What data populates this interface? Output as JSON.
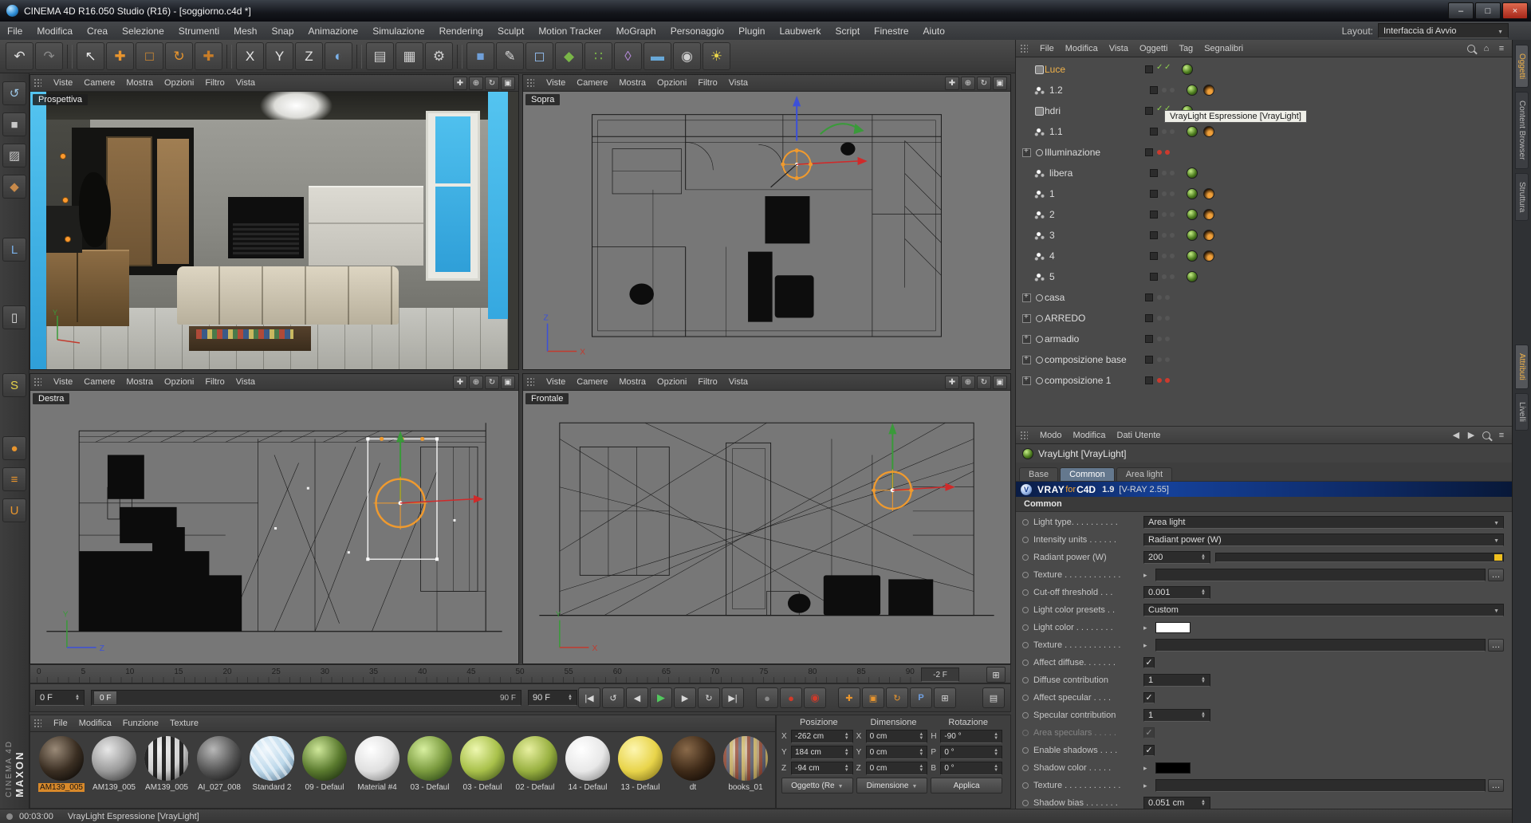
{
  "window": {
    "title": "CINEMA 4D R16.050 Studio (R16) - [soggiorno.c4d *]",
    "controls": {
      "minimize": "–",
      "maximize": "□",
      "close": "×"
    }
  },
  "menubar": {
    "items": [
      "File",
      "Modifica",
      "Crea",
      "Selezione",
      "Strumenti",
      "Mesh",
      "Snap",
      "Animazione",
      "Simulazione",
      "Rendering",
      "Sculpt",
      "Motion Tracker",
      "MoGraph",
      "Personaggio",
      "Plugin",
      "Laubwerk",
      "Script",
      "Finestre",
      "Aiuto"
    ],
    "layout_label": "Layout:",
    "layout_value": "Interfaccia di Avvio"
  },
  "toolbar": {
    "items": [
      {
        "name": "undo-icon",
        "g": "↶",
        "c": "#e0e0e0",
        "cls": "",
        "inter": "true"
      },
      {
        "name": "redo-icon",
        "g": "↷",
        "c": "#8a8a8a",
        "cls": "",
        "inter": "true"
      },
      {
        "name": "toolbar-separator",
        "g": "",
        "c": "",
        "cls": "tsep",
        "inter": "false"
      },
      {
        "name": "live-selection-icon",
        "g": "↖",
        "c": "#e8e8e8",
        "cls": "",
        "inter": "true"
      },
      {
        "name": "move-tool-icon",
        "g": "✚",
        "c": "#e8952e",
        "cls": "",
        "inter": "true"
      },
      {
        "name": "scale-tool-icon",
        "g": "□",
        "c": "#e8952e",
        "cls": "",
        "inter": "true"
      },
      {
        "name": "rotate-tool-icon",
        "g": "↻",
        "c": "#e8952e",
        "cls": "",
        "inter": "true"
      },
      {
        "name": "last-tool-icon",
        "g": "✚",
        "c": "#c87d28",
        "cls": "",
        "inter": "true"
      },
      {
        "name": "toolbar-separator",
        "g": "",
        "c": "",
        "cls": "tsep",
        "inter": "false"
      },
      {
        "name": "lock-x-button",
        "g": "X",
        "c": "#e4e4e4",
        "cls": "",
        "inter": "true"
      },
      {
        "name": "lock-y-button",
        "g": "Y",
        "c": "#e4e4e4",
        "cls": "",
        "inter": "true"
      },
      {
        "name": "lock-z-button",
        "g": "Z",
        "c": "#e4e4e4",
        "cls": "",
        "inter": "true"
      },
      {
        "name": "coord-system-icon",
        "g": "◐",
        "c": "#7ab0e8",
        "cls": "",
        "inter": "true"
      },
      {
        "name": "toolbar-separator",
        "g": "",
        "c": "",
        "cls": "tsep",
        "inter": "false"
      },
      {
        "name": "render-view-icon",
        "g": "▤",
        "c": "#cfcfcf",
        "cls": "",
        "inter": "true"
      },
      {
        "name": "render-picture-viewer-icon",
        "g": "▦",
        "c": "#cfcfcf",
        "cls": "",
        "inter": "true"
      },
      {
        "name": "render-settings-icon",
        "g": "⚙",
        "c": "#cfcfcf",
        "cls": "",
        "inter": "true"
      },
      {
        "name": "toolbar-separator",
        "g": "",
        "c": "",
        "cls": "tsep",
        "inter": "false"
      },
      {
        "name": "primitive-cube-icon",
        "g": "■",
        "c": "#6f9fd8",
        "cls": "",
        "inter": "true"
      },
      {
        "name": "spline-pen-icon",
        "g": "✎",
        "c": "#d8d8d8",
        "cls": "",
        "inter": "true"
      },
      {
        "name": "subdivision-surface-icon",
        "g": "◻",
        "c": "#8fb8e8",
        "cls": "",
        "inter": "true"
      },
      {
        "name": "cloner-icon",
        "g": "◆",
        "c": "#7ab648",
        "cls": "",
        "inter": "true"
      },
      {
        "name": "array-icon",
        "g": "∷",
        "c": "#7ab648",
        "cls": "",
        "inter": "true"
      },
      {
        "name": "deformer-icon",
        "g": "◊",
        "c": "#b48ad8",
        "cls": "",
        "inter": "true"
      },
      {
        "name": "floor-object-icon",
        "g": "▬",
        "c": "#68a8d8",
        "cls": "",
        "inter": "true"
      },
      {
        "name": "camera-object-icon",
        "g": "◉",
        "c": "#cfcfcf",
        "cls": "",
        "inter": "true"
      },
      {
        "name": "light-object-icon",
        "g": "☀",
        "c": "#e8d44a",
        "cls": "",
        "inter": "true"
      }
    ]
  },
  "leftbar": {
    "items": [
      {
        "name": "make-editable-icon",
        "g": "↺",
        "c": "#9ec8e8",
        "cls": ""
      },
      {
        "name": "model-mode-icon",
        "g": "■",
        "c": "#c8c8c8",
        "cls": ""
      },
      {
        "name": "texture-mode-icon",
        "g": "▨",
        "c": "#c8c8c8",
        "cls": ""
      },
      {
        "name": "polygons-mode-icon",
        "g": "◆",
        "c": "#c88a4a",
        "cls": ""
      },
      {
        "name": "axis-mode-icon",
        "g": "L",
        "c": "#7ab0e8",
        "cls": "gap"
      },
      {
        "name": "viewport-nav-icon",
        "g": "▯",
        "c": "#e0e0e0",
        "cls": "biggap"
      },
      {
        "name": "snap-icon",
        "g": "S",
        "c": "#e8d44a",
        "cls": "biggap"
      },
      {
        "name": "paint-tool-icon",
        "g": "●",
        "c": "#e8952e",
        "cls": "gap"
      },
      {
        "name": "layers-icon",
        "g": "≡",
        "c": "#e8952e",
        "cls": ""
      },
      {
        "name": "magnet-icon",
        "g": "U",
        "c": "#e8952e",
        "cls": ""
      }
    ]
  },
  "axis": {
    "x": "X",
    "y": "Y",
    "z": "Z"
  },
  "viewport_menus": [
    "Viste",
    "Camere",
    "Mostra",
    "Opzioni",
    "Filtro",
    "Vista"
  ],
  "vp_icons": [
    {
      "name": "pan-view-icon",
      "g": "✚"
    },
    {
      "name": "zoom-view-icon",
      "g": "⊕"
    },
    {
      "name": "rotate-view-icon",
      "g": "↻"
    },
    {
      "name": "maximize-view-icon",
      "g": "▣"
    }
  ],
  "viewports": {
    "v1": "Prospettiva",
    "v2": "Sopra",
    "v3": "Destra",
    "v4": "Frontale"
  },
  "object_manager": {
    "menus": [
      "File",
      "Modifica",
      "Vista",
      "Oggetti",
      "Tag",
      "Segnalibri"
    ],
    "tooltip": "VrayLight Espressione [VrayLight]",
    "objects": [
      {
        "nm": "object-row-luce",
        "name": "Luce",
        "icon": "ic-null",
        "exp": "",
        "sel": "sel",
        "dots": "dots-check",
        "tag1": "tag-vray",
        "tag2": "tag-none"
      },
      {
        "nm": "object-row-1-2",
        "name": "1.2",
        "icon": "ic-light",
        "exp": "",
        "sel": "",
        "dots": "dots-gray",
        "tag1": "tag-vray",
        "tag2": "tag-orange"
      },
      {
        "nm": "object-row-hdri",
        "name": "hdri",
        "icon": "ic-null",
        "exp": "",
        "sel": "",
        "dots": "dots-check",
        "tag1": "tag-vray",
        "tag2": "tag-none"
      },
      {
        "nm": "object-row-1-1",
        "name": "1.1",
        "icon": "ic-light",
        "exp": "",
        "sel": "",
        "dots": "dots-gray",
        "tag1": "tag-vray",
        "tag2": "tag-orange"
      },
      {
        "nm": "object-row-illuminazione",
        "name": "Illuminazione",
        "icon": "ic-nullL",
        "exp": "has-exp",
        "sel": "",
        "dots": "dots-red",
        "tag1": "tag-none",
        "tag2": "tag-none"
      },
      {
        "nm": "object-row-libera",
        "name": "libera",
        "icon": "ic-light",
        "exp": "",
        "sel": "",
        "dots": "dots-gray",
        "tag1": "tag-vray",
        "tag2": "tag-none"
      },
      {
        "nm": "object-row-1",
        "name": "1",
        "icon": "ic-light",
        "exp": "",
        "sel": "",
        "dots": "dots-gray",
        "tag1": "tag-vray",
        "tag2": "tag-orange"
      },
      {
        "nm": "object-row-2",
        "name": "2",
        "icon": "ic-light",
        "exp": "",
        "sel": "",
        "dots": "dots-gray",
        "tag1": "tag-vray",
        "tag2": "tag-orange"
      },
      {
        "nm": "object-row-3",
        "name": "3",
        "icon": "ic-light",
        "exp": "",
        "sel": "",
        "dots": "dots-gray",
        "tag1": "tag-vray",
        "tag2": "tag-orange"
      },
      {
        "nm": "object-row-4",
        "name": "4",
        "icon": "ic-light",
        "exp": "",
        "sel": "",
        "dots": "dots-gray",
        "tag1": "tag-vray",
        "tag2": "tag-orange"
      },
      {
        "nm": "object-row-5",
        "name": "5",
        "icon": "ic-light",
        "exp": "",
        "sel": "",
        "dots": "dots-gray",
        "tag1": "tag-vray",
        "tag2": "tag-none"
      },
      {
        "nm": "object-row-casa",
        "name": "casa",
        "icon": "ic-nullL",
        "exp": "has-exp",
        "sel": "",
        "dots": "dots-gray",
        "tag1": "tag-none",
        "tag2": "tag-none"
      },
      {
        "nm": "object-row-arredo",
        "name": "ARREDO",
        "icon": "ic-nullL",
        "exp": "has-exp",
        "sel": "",
        "dots": "dots-gray",
        "tag1": "tag-none",
        "tag2": "tag-none"
      },
      {
        "nm": "object-row-armadio",
        "name": "armadio",
        "icon": "ic-nullL",
        "exp": "has-exp",
        "sel": "",
        "dots": "dots-gray",
        "tag1": "tag-none",
        "tag2": "tag-none"
      },
      {
        "nm": "object-row-composizione-base",
        "name": "composizione base",
        "icon": "ic-nullL",
        "exp": "has-exp",
        "sel": "",
        "dots": "dots-gray",
        "tag1": "tag-none",
        "tag2": "tag-none"
      },
      {
        "nm": "object-row-composizione-1",
        "name": "composizione 1",
        "icon": "ic-nullL",
        "exp": "has-exp",
        "sel": "",
        "dots": "dots-red",
        "tag1": "tag-none",
        "tag2": "tag-none"
      }
    ]
  },
  "attributes": {
    "menus": [
      "Modo",
      "Modifica",
      "Dati Utente"
    ],
    "title": "VrayLight [VrayLight]",
    "tabs": [
      {
        "label": "Base",
        "cls": ""
      },
      {
        "label": "Common",
        "cls": "active"
      },
      {
        "label": "Area light",
        "cls": ""
      }
    ],
    "banner": {
      "v": "VRAY",
      "f": "for",
      "c": "C4D",
      "ver": "1.9",
      "vray": "[V-RAY 2.55]"
    },
    "section": "Common",
    "rows": [
      {
        "nm": "prop-light-type",
        "k": "k-drop",
        "label": "Light type. . . . . . . . . .",
        "value": "Area light"
      },
      {
        "nm": "prop-intensity-units",
        "k": "k-drop",
        "label": "Intensity units . . . . . .",
        "value": "Radiant power (W)"
      },
      {
        "nm": "prop-radiant-power",
        "k": "k-slider",
        "label": "Radiant power (W)",
        "value": "200"
      },
      {
        "nm": "prop-texture-1",
        "k": "k-tex",
        "label": "Texture . . . . . . . . . . . .",
        "value": ""
      },
      {
        "nm": "prop-cutoff-threshold",
        "k": "k-num",
        "label": "Cut-off threshold . . .",
        "value": "0.001"
      },
      {
        "nm": "prop-light-color-presets",
        "k": "k-drop",
        "label": "Light color presets . .",
        "value": "Custom"
      },
      {
        "nm": "prop-light-color",
        "k": "k-color",
        "label": "Light color . . . . . . . .",
        "value": "#ffffff"
      },
      {
        "nm": "prop-texture-2",
        "k": "k-tex",
        "label": "Texture . . . . . . . . . . . .",
        "value": ""
      },
      {
        "nm": "prop-affect-diffuse",
        "k": "k-check",
        "label": "Affect diffuse. . . . . . .",
        "value": "✓"
      },
      {
        "nm": "prop-diffuse-contribution",
        "k": "k-num",
        "label": "Diffuse contribution",
        "value": "1"
      },
      {
        "nm": "prop-affect-specular",
        "k": "k-check",
        "label": "Affect specular . . . .",
        "value": "✓"
      },
      {
        "nm": "prop-specular-contribution",
        "k": "k-num",
        "label": "Specular contribution",
        "value": "1"
      },
      {
        "nm": "prop-area-speculars",
        "k": "k-check k-dim",
        "label": "Area speculars . . . . .",
        "value": "✓"
      },
      {
        "nm": "prop-enable-shadows",
        "k": "k-check",
        "label": "Enable shadows . . . .",
        "value": "✓"
      },
      {
        "nm": "prop-shadow-color",
        "k": "k-color",
        "label": "Shadow color . . . . .",
        "value": "#000000"
      },
      {
        "nm": "prop-texture-3",
        "k": "k-tex",
        "label": "Texture . . . . . . . . . . . .",
        "value": ""
      },
      {
        "nm": "prop-shadow-bias",
        "k": "k-num",
        "label": "Shadow bias . . . . . . .",
        "value": "0.051 cm"
      }
    ]
  },
  "timeline": {
    "ruler": [
      "0",
      "5",
      "10",
      "15",
      "20",
      "25",
      "30",
      "35",
      "40",
      "45",
      "50",
      "55",
      "60",
      "65",
      "70",
      "75",
      "80",
      "85",
      "90"
    ],
    "end_label": "-2 F",
    "frame_field": "0 F",
    "range_start": "0 F",
    "range_end": "90 F",
    "end_field": "90 F",
    "menu_glyph": "⊞",
    "layout_glyph": "▤",
    "buttons": [
      {
        "name": "goto-start-button",
        "g": "|◀",
        "cls": ""
      },
      {
        "name": "play-backward-button",
        "g": "↺",
        "cls": ""
      },
      {
        "name": "prev-frame-button",
        "g": "◀",
        "cls": ""
      },
      {
        "name": "play-button",
        "g": "▶",
        "cls": "green"
      },
      {
        "name": "next-frame-button",
        "g": "▶",
        "cls": ""
      },
      {
        "name": "play-loop-button",
        "g": "↻",
        "cls": ""
      },
      {
        "name": "goto-end-button",
        "g": "▶|",
        "cls": ""
      },
      {
        "name": "record-button",
        "g": "●",
        "cls": "gap dim"
      },
      {
        "name": "autokey-button",
        "g": "●",
        "cls": "red"
      },
      {
        "name": "keyframe-selection-button",
        "g": "◉",
        "cls": "red"
      },
      {
        "name": "key-position-button",
        "g": "✚",
        "cls": "gap orange"
      },
      {
        "name": "key-scale-button",
        "g": "▣",
        "cls": "orange"
      },
      {
        "name": "key-rotation-button",
        "g": "↻",
        "cls": "orange"
      },
      {
        "name": "key-parameter-button",
        "g": "P",
        "cls": "blue"
      },
      {
        "name": "key-pla-button",
        "g": "⊞",
        "cls": ""
      }
    ]
  },
  "materials": {
    "menus": [
      "File",
      "Modifica",
      "Funzione",
      "Texture"
    ],
    "items": [
      {
        "name": "AM139_005",
        "sel": "sel",
        "pat": "",
        "c1": "#9a8a78",
        "c2": "#3a2e22",
        "c3": "#0d0a07"
      },
      {
        "name": "AM139_005",
        "sel": "",
        "pat": "",
        "c1": "#e8e8e8",
        "c2": "#9a9a9a",
        "c3": "#404040"
      },
      {
        "name": "AM139_005",
        "sel": "",
        "pat": "pat-stripes",
        "c1": "#f0f0f0",
        "c2": "#cfcfcf",
        "c3": "#555555"
      },
      {
        "name": "AI_027_008",
        "sel": "",
        "pat": "",
        "c1": "#b8b8b8",
        "c2": "#555555",
        "c3": "#1a1a1a"
      },
      {
        "name": "Standard 2",
        "sel": "",
        "pat": "pat-stripes-diag",
        "c1": "#eef6fc",
        "c2": "#bcd8ea",
        "c3": "#6a88a0"
      },
      {
        "name": "09 - Defaul",
        "sel": "",
        "pat": "",
        "c1": "#cfe89a",
        "c2": "#5a7a2e",
        "c3": "#1e3010"
      },
      {
        "name": "Material #4",
        "sel": "",
        "pat": "",
        "c1": "#ffffff",
        "c2": "#e0e0e0",
        "c3": "#8a8a8a"
      },
      {
        "name": "03 - Defaul",
        "sel": "",
        "pat": "",
        "c1": "#d8f0a0",
        "c2": "#7a9a3e",
        "c3": "#2e4a18"
      },
      {
        "name": "03 - Defaul",
        "sel": "",
        "pat": "",
        "c1": "#eef8b0",
        "c2": "#a8c04a",
        "c3": "#4a5e1e"
      },
      {
        "name": "02 - Defaul",
        "sel": "",
        "pat": "",
        "c1": "#e8f0a0",
        "c2": "#98b040",
        "c3": "#3e5018"
      },
      {
        "name": "14 - Defaul",
        "sel": "",
        "pat": "",
        "c1": "#ffffff",
        "c2": "#e8e8e8",
        "c3": "#909090"
      },
      {
        "name": "13 - Defaul",
        "sel": "",
        "pat": "",
        "c1": "#fdf6b0",
        "c2": "#e8d44a",
        "c3": "#8a7a1e"
      },
      {
        "name": "dt",
        "sel": "",
        "pat": "",
        "c1": "#8a6a4a",
        "c2": "#3e2a18",
        "c3": "#140c06"
      },
      {
        "name": "books_01",
        "sel": "",
        "pat": "pat-books",
        "c1": "#e8d8c0",
        "c2": "#b09878",
        "c3": "#504030"
      }
    ]
  },
  "coordinates": {
    "headers": {
      "pos": "Posizione",
      "dim": "Dimensione",
      "rot": "Rotazione"
    },
    "pos": [
      {
        "a": "X",
        "v": "-262 cm"
      },
      {
        "a": "Y",
        "v": "184 cm"
      },
      {
        "a": "Z",
        "v": "-94 cm"
      }
    ],
    "dim": [
      {
        "a": "X",
        "v": "0 cm"
      },
      {
        "a": "Y",
        "v": "0 cm"
      },
      {
        "a": "Z",
        "v": "0 cm"
      }
    ],
    "rot": [
      {
        "a": "H",
        "v": "-90 °"
      },
      {
        "a": "P",
        "v": "0 °"
      },
      {
        "a": "B",
        "v": "0 °"
      }
    ],
    "buttons": {
      "target": "Oggetto (Re",
      "mode": "Dimensione",
      "apply": "Applica"
    }
  },
  "right_tabs_top": [
    {
      "label": "Oggetti",
      "cls": "active"
    },
    {
      "label": "Content Browser",
      "cls": ""
    },
    {
      "label": "Struttura",
      "cls": ""
    }
  ],
  "right_tabs_bottom": [
    {
      "label": "Attributi",
      "cls": "active"
    },
    {
      "label": "Livelli",
      "cls": ""
    }
  ],
  "brand": {
    "maxon": "MAXON",
    "cinema": "CINEMA 4D"
  },
  "statusbar": {
    "time": "00:03:00",
    "message": "VrayLight Espressione [VrayLight]"
  }
}
